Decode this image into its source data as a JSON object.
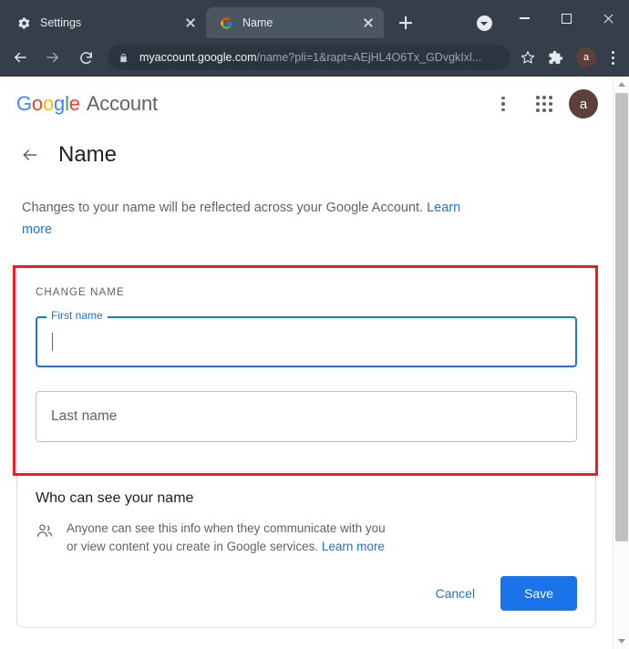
{
  "browser": {
    "tabs": [
      {
        "title": "Settings",
        "favicon": "gear-icon",
        "active": false
      },
      {
        "title": "Name",
        "favicon": "google-g-icon",
        "active": true
      }
    ],
    "new_tab_label": "+",
    "window_controls": {
      "minimize": "–",
      "maximize": "□",
      "close": "×"
    },
    "address": {
      "lock_icon": "lock-icon",
      "domain": "myaccount.google.com",
      "path": "/name?pli=1&rapt=AEjHL4O6Tx_GDvgkIxl...",
      "full_url": "myaccount.google.com/name?pli=1&rapt=AEjHL4O6Tx_GDvgkIxl..."
    },
    "profile_initial": "a",
    "profile_color": "#5d4037"
  },
  "header": {
    "logo": {
      "g1": "G",
      "o1": "o",
      "o2": "o",
      "g2": "g",
      "l": "l",
      "e": "e"
    },
    "product": "Account",
    "avatar_initial": "a"
  },
  "page": {
    "title": "Name",
    "intro_text": "Changes to your name will be reflected across your Google Account.",
    "intro_link": "Learn more"
  },
  "form": {
    "section_label": "CHANGE NAME",
    "first_name": {
      "label": "First name",
      "value": "",
      "focused": true
    },
    "last_name": {
      "placeholder": "Last name",
      "value": ""
    }
  },
  "visibility": {
    "heading": "Who can see your name",
    "icon": "people-icon",
    "text": "Anyone can see this info when they communicate with you or view content you create in Google services.",
    "link": "Learn more"
  },
  "actions": {
    "cancel_label": "Cancel",
    "save_label": "Save",
    "save_color": "#1a73e8"
  },
  "annotation": {
    "color": "#ee1c25"
  }
}
